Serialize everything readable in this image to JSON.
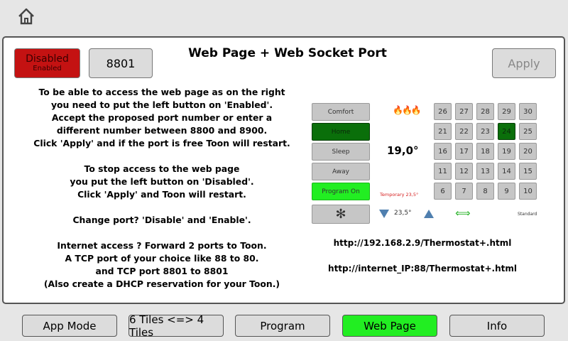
{
  "toggle": {
    "state_label": "Disabled",
    "sub_label": "Enabled"
  },
  "port_value": "8801",
  "title": "Web Page + Web Socket Port",
  "apply_label": "Apply",
  "instructions": {
    "block1": [
      "To be able to access the web page as on the right",
      "you need to put the left button on 'Enabled'.",
      "Accept the proposed port number or enter a",
      "different number between 8800 and 8900.",
      "Click 'Apply' and if the port is free Toon will restart."
    ],
    "block2": [
      "To stop access to the web page",
      "you put the left button on 'Disabled'.",
      "Click 'Apply' and Toon will restart."
    ],
    "block3": [
      "Change port? 'Disable' and 'Enable'."
    ],
    "block4": [
      "Internet access ? Forward 2 ports to Toon.",
      "A TCP port of your choice like 88 to 80.",
      "and TCP port 8801 to 8801",
      "(Also create a DHCP reservation for your Toon.)"
    ]
  },
  "preview": {
    "modes": [
      "Comfort",
      "Home",
      "Sleep",
      "Away",
      "Program On"
    ],
    "active_mode": "Home",
    "temperature": "19,0°",
    "temporary_label": "Temporary 23,5°",
    "setpoint": "23,5°",
    "standard_label": "Standard",
    "grid": [
      [
        26,
        27,
        28,
        29,
        30
      ],
      [
        21,
        22,
        23,
        24,
        25
      ],
      [
        16,
        17,
        18,
        19,
        20
      ],
      [
        11,
        12,
        13,
        14,
        15
      ],
      [
        6,
        7,
        8,
        9,
        10
      ]
    ],
    "selected_value": 24,
    "colors": {
      "home_active": "#0a6f0a",
      "program_on": "#22ee22",
      "selected_cell": "#0a6f0a",
      "flame": "#e86a00",
      "arrow_blue": "#4f7faf",
      "swap_arrow": "#2fb52f"
    }
  },
  "urls": {
    "local": "http://192.168.2.9/Thermostat+.html",
    "internet": "http://internet_IP:88/Thermostat+.html"
  },
  "tabs": [
    {
      "label": "App Mode",
      "active": false
    },
    {
      "label": "6 Tiles <=> 4 Tiles",
      "active": false
    },
    {
      "label": "Program",
      "active": false
    },
    {
      "label": "Web Page",
      "active": true
    },
    {
      "label": "Info",
      "active": false
    }
  ],
  "tab_active_color": "#22ee22"
}
